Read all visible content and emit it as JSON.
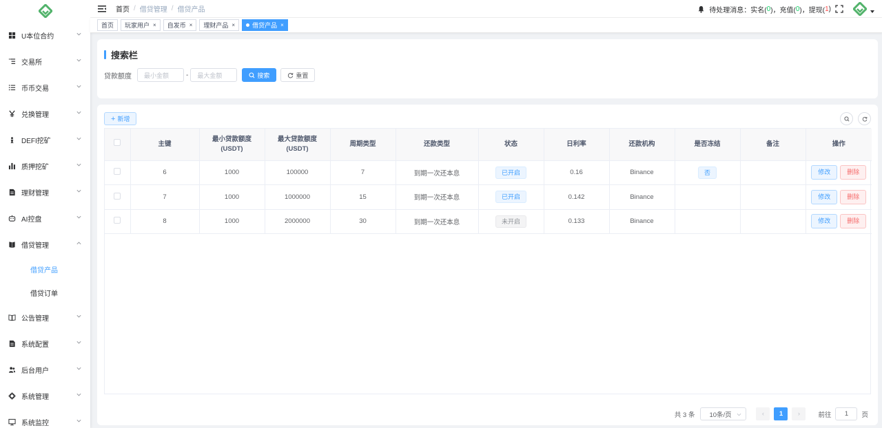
{
  "colors": {
    "accent": "#409eff",
    "logo": "#52b36b"
  },
  "sidebar": {
    "items": [
      {
        "label": "U本位合约",
        "icon": "grid-icon"
      },
      {
        "label": "交易所",
        "icon": "list-indent-icon"
      },
      {
        "label": "币币交易",
        "icon": "list-icon"
      },
      {
        "label": "兑换管理",
        "icon": "yen-icon"
      },
      {
        "label": "DEFI挖矿",
        "icon": "person-icon"
      },
      {
        "label": "质押挖矿",
        "icon": "bar-chart-icon"
      },
      {
        "label": "理财管理",
        "icon": "document-icon"
      },
      {
        "label": "AI控盘",
        "icon": "robot-icon"
      },
      {
        "label": "借贷管理",
        "icon": "book-icon",
        "expanded": true,
        "children": [
          {
            "label": "借贷产品",
            "active": true
          },
          {
            "label": "借贷订单"
          }
        ]
      },
      {
        "label": "公告管理",
        "icon": "open-book-icon"
      },
      {
        "label": "系统配置",
        "icon": "document-icon"
      },
      {
        "label": "后台用户",
        "icon": "users-icon"
      },
      {
        "label": "系统管理",
        "icon": "gear-icon"
      },
      {
        "label": "系统监控",
        "icon": "monitor-icon"
      }
    ]
  },
  "header": {
    "breadcrumb": [
      "首页",
      "借贷管理",
      "借贷产品"
    ],
    "notice": {
      "prefix": "待处理消息：实名(",
      "realname": "0",
      "mid1": ")，充值(",
      "recharge": "0",
      "mid2": ")，提现(",
      "withdraw": "1",
      "suffix": ")"
    }
  },
  "tags": [
    {
      "label": "首页",
      "closable": false
    },
    {
      "label": "玩家用户",
      "closable": true
    },
    {
      "label": "自发币",
      "closable": true
    },
    {
      "label": "理财产品",
      "closable": true
    },
    {
      "label": "借贷产品",
      "closable": true,
      "active": true
    }
  ],
  "search": {
    "title": "搜索栏",
    "label": "贷款额度",
    "min_placeholder": "最小金额",
    "max_placeholder": "最大金额",
    "dash": "-",
    "search_label": "搜索",
    "reset_label": "重置"
  },
  "toolbar": {
    "add_label": "新增"
  },
  "table": {
    "columns": [
      "主键",
      "最小贷款额度(USDT)",
      "最大贷款额度(USDT)",
      "周期类型",
      "还款类型",
      "状态",
      "日利率",
      "还款机构",
      "是否冻结",
      "备注",
      "操作"
    ],
    "rows": [
      {
        "id": "6",
        "min": "1000",
        "max": "100000",
        "period": "7",
        "repay": "到期一次还本息",
        "status": "已开启",
        "status_on": true,
        "rate": "0.16",
        "org": "Binance",
        "frozen": "否",
        "remark": ""
      },
      {
        "id": "7",
        "min": "1000",
        "max": "1000000",
        "period": "15",
        "repay": "到期一次还本息",
        "status": "已开启",
        "status_on": true,
        "rate": "0.142",
        "org": "Binance",
        "frozen": "",
        "remark": ""
      },
      {
        "id": "8",
        "min": "1000",
        "max": "2000000",
        "period": "30",
        "repay": "到期一次还本息",
        "status": "未开启",
        "status_on": false,
        "rate": "0.133",
        "org": "Binance",
        "frozen": "",
        "remark": ""
      }
    ],
    "edit_label": "修改",
    "delete_label": "删除"
  },
  "pagination": {
    "total": "共 3 条",
    "page_size": "10条/页",
    "current": "1",
    "goto_label": "前往",
    "goto_value": "1",
    "page_unit": "页"
  }
}
